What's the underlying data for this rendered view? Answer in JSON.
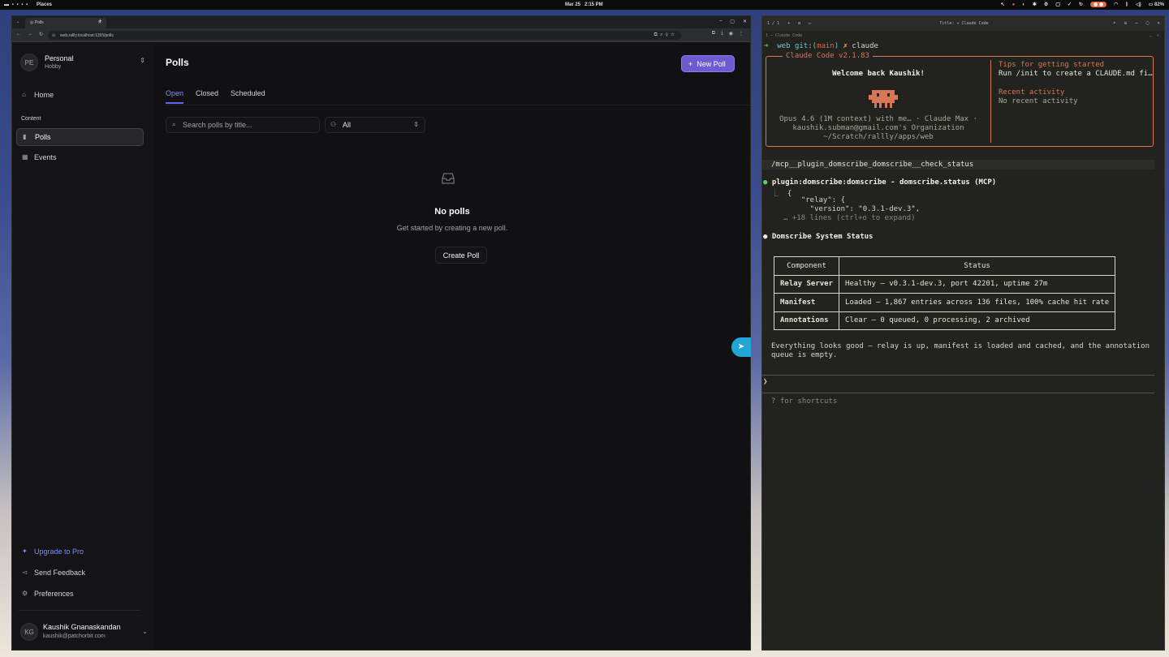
{
  "topbar": {
    "workspaces": "▬ ▪ ▪ ▪ ▪",
    "places": "Places",
    "date": "Mar 25",
    "time": "2:15 PM",
    "battery": "82%"
  },
  "browser": {
    "tab_title": "Polls",
    "url": "web.rallly.localhost:1355/polls"
  },
  "sidebar": {
    "workspace": {
      "initials": "PE",
      "name": "Personal",
      "plan": "Hobby"
    },
    "nav": [
      {
        "label": "Home",
        "icon": "home-icon"
      }
    ],
    "section_label": "Content",
    "content_items": [
      {
        "label": "Polls",
        "icon": "bar-chart-icon"
      },
      {
        "label": "Events",
        "icon": "calendar-icon"
      }
    ],
    "footer": [
      {
        "label": "Upgrade to Pro",
        "icon": "sparkle-icon"
      },
      {
        "label": "Send Feedback",
        "icon": "megaphone-icon"
      },
      {
        "label": "Preferences",
        "icon": "settings-icon"
      }
    ],
    "user": {
      "initials": "KG",
      "name": "Kaushik Gnanaskandan",
      "email": "kaushik@patchorbit.com"
    }
  },
  "main": {
    "title": "Polls",
    "new_poll_label": "New Poll",
    "tabs": [
      "Open",
      "Closed",
      "Scheduled"
    ],
    "search_placeholder": "Search polls by title...",
    "filter_value": "All",
    "empty_title": "No polls",
    "empty_subtitle": "Get started by creating a new poll.",
    "create_label": "Create Poll"
  },
  "terminal": {
    "window_title": "Title: ✳ Claude Code",
    "tab_counter": "1 / 1",
    "session_label": "1 — Claude Code",
    "prompt_dir": "web",
    "prompt_git": "git:(",
    "prompt_branch": "main",
    "prompt_git_end": ")",
    "prompt_x": "✗",
    "prompt_cmd": "claude",
    "banner_title": "Claude Code v2.1.83",
    "welcome": "Welcome back Kaushik!",
    "model_line": "Opus 4.6 (1M context) with me… · Claude Max ·",
    "org_line": "kaushik.subman@gmail.com's Organization",
    "dir_line": "~/Scratch/rallly/apps/web",
    "tips_heading": "Tips for getting started",
    "tips_text": "Run /init to create a CLAUDE.md fi…",
    "recent_heading": "Recent activity",
    "recent_text": "No recent activity",
    "slash_cmd": "/mcp__plugin_domscribe_domscribe__check_status",
    "tool_call": "plugin:domscribe:domscribe - domscribe.status (MCP)",
    "json_lines": [
      "{",
      "  \"relay\": {",
      "    \"version\": \"0.3.1-dev.3\","
    ],
    "expand_hint": "… +18 lines (ctrl+o to expand)",
    "status_heading": "Domscribe System Status",
    "table_headers": [
      "Component",
      "Status"
    ],
    "table_rows": [
      [
        "Relay Server",
        "Healthy — v0.3.1-dev.3, port 42201, uptime 27m"
      ],
      [
        "Manifest",
        "Loaded — 1,867 entries across 136 files, 100% cache hit rate"
      ],
      [
        "Annotations",
        "Clear — 0 queued, 0 processing, 2 archived"
      ]
    ],
    "summary_line1": "Everything looks good — relay is up, manifest is loaded and cached, and the annotation",
    "summary_line2": "queue is empty.",
    "input_prompt": "❯",
    "shortcuts_hint": "? for shortcuts",
    "accent": "#d77757"
  }
}
